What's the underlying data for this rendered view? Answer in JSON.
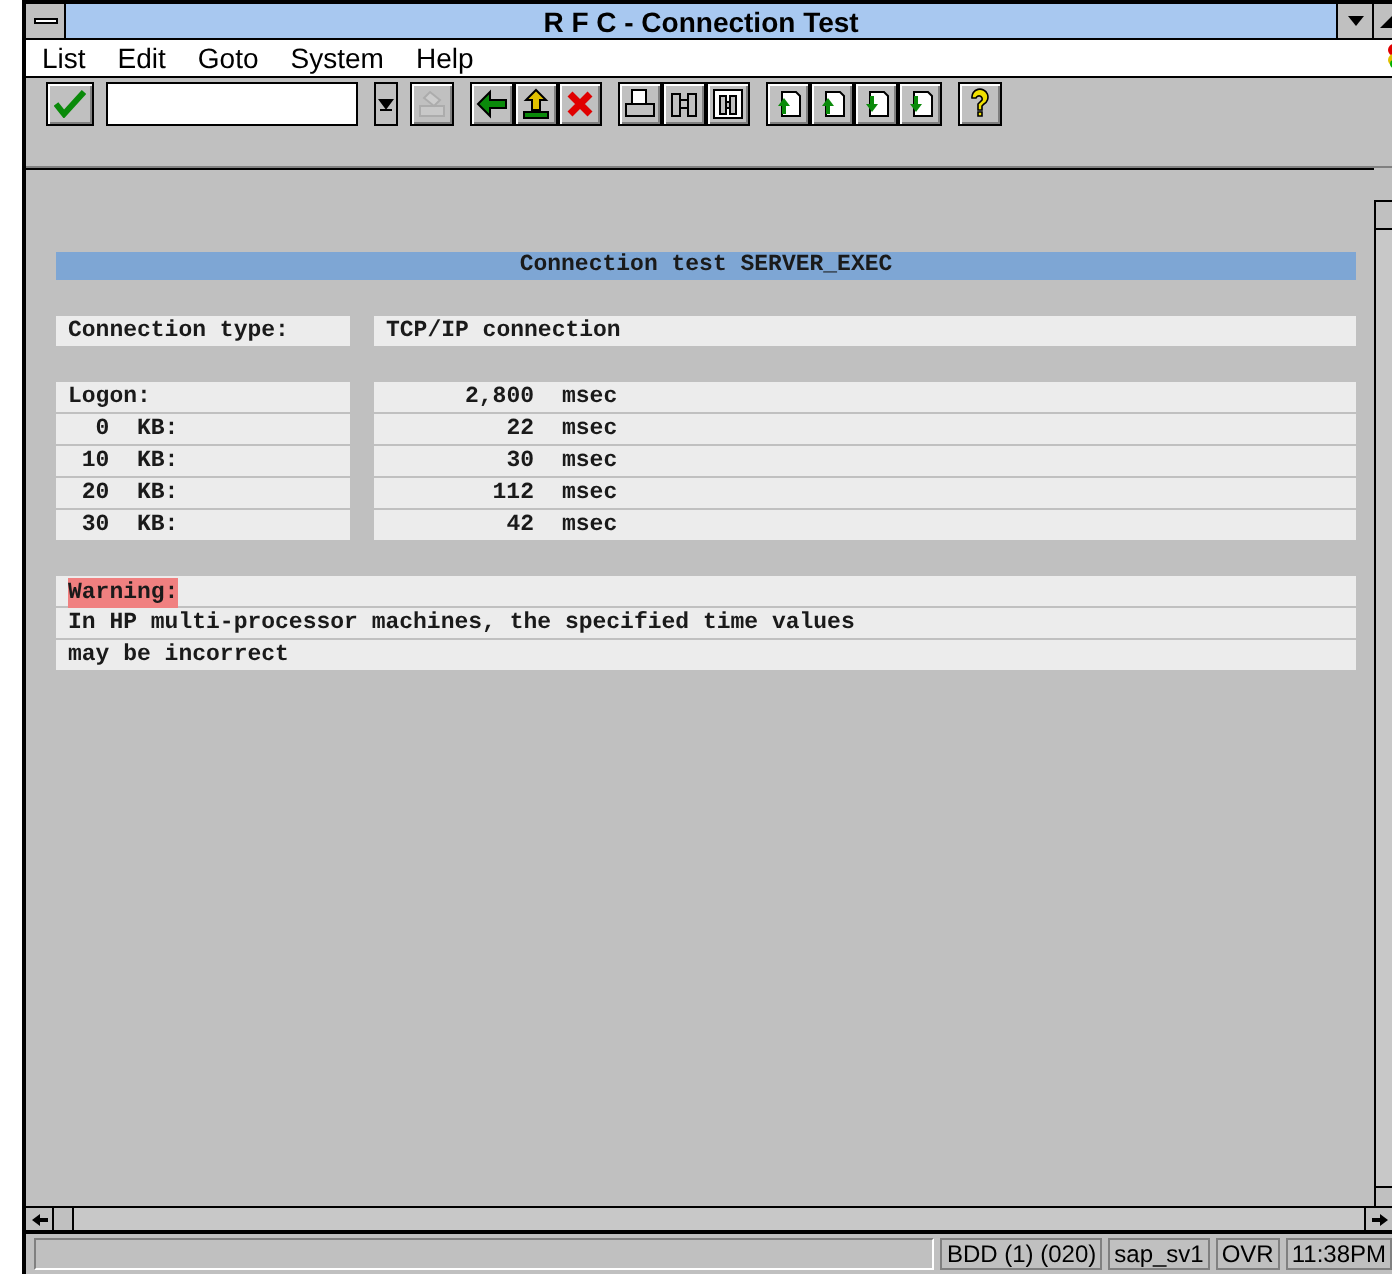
{
  "window": {
    "title": "R F C - Connection Test"
  },
  "menu": [
    "List",
    "Edit",
    "Goto",
    "System",
    "Help"
  ],
  "toolbar": [
    {
      "kind": "enter"
    },
    {
      "kind": "command"
    },
    {
      "kind": "dropdown"
    },
    {
      "kind": "save",
      "disabled": true
    },
    {
      "kind": "gap"
    },
    {
      "kind": "back",
      "disabled": false
    },
    {
      "kind": "exit",
      "disabled": false
    },
    {
      "kind": "cancel",
      "disabled": false
    },
    {
      "kind": "gap"
    },
    {
      "kind": "print",
      "disabled": false
    },
    {
      "kind": "find",
      "disabled": false
    },
    {
      "kind": "find-next",
      "disabled": false
    },
    {
      "kind": "gap"
    },
    {
      "kind": "first-page",
      "disabled": false
    },
    {
      "kind": "previous-page",
      "disabled": false
    },
    {
      "kind": "next-page",
      "disabled": false
    },
    {
      "kind": "last-page",
      "disabled": false
    },
    {
      "kind": "gap"
    },
    {
      "kind": "help",
      "disabled": false
    }
  ],
  "list": {
    "heading": "Connection test SERVER_EXEC",
    "connection": {
      "label": "Connection type:",
      "value": "TCP/IP connection"
    },
    "timings": [
      {
        "label": "Logon:",
        "value": "2,800",
        "unit": "msec"
      },
      {
        "label": "  0  KB:",
        "value": "22",
        "unit": "msec"
      },
      {
        "label": " 10  KB:",
        "value": "30",
        "unit": "msec"
      },
      {
        "label": " 20  KB:",
        "value": "112",
        "unit": "msec"
      },
      {
        "label": " 30  KB:",
        "value": "42",
        "unit": "msec"
      }
    ],
    "warning": {
      "label": "Warning:",
      "lines": [
        "In HP multi-processor machines, the specified time values",
        "may be incorrect"
      ]
    }
  },
  "status_bar": [
    "BDD (1) (020)",
    "sap_sv1",
    "OVR",
    "11:38PM"
  ]
}
